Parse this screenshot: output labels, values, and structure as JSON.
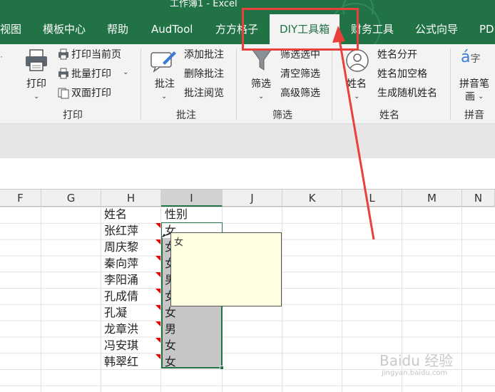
{
  "window": {
    "title": "工作簿1  -  Excel"
  },
  "tabs": [
    {
      "label": "视图",
      "active": false
    },
    {
      "label": "模板中心",
      "active": false
    },
    {
      "label": "帮助",
      "active": false
    },
    {
      "label": "AudTool",
      "active": false
    },
    {
      "label": "方方格子",
      "active": false
    },
    {
      "label": "DIY工具箱",
      "active": true
    },
    {
      "label": "财务工具",
      "active": false
    },
    {
      "label": "公式向导",
      "active": false
    },
    {
      "label": "PD",
      "active": false
    }
  ],
  "ribbon": {
    "print_group": {
      "print_label": "打印",
      "print_current_page": "打印当前页",
      "batch_print": "批量打印",
      "duplex_print": "双面打印",
      "group_name": "打印"
    },
    "comment_group": {
      "comment_label": "批注",
      "add_comment": "添加批注",
      "delete_comment": "删除批注",
      "comment_review": "批注阅览",
      "group_name": "批注"
    },
    "filter_group": {
      "filter_label": "筛选",
      "filter_selected": "筛选选中",
      "clear_filter": "清空筛选",
      "advanced_filter": "高级筛选",
      "group_name": "筛选"
    },
    "name_group": {
      "name_label": "姓名",
      "name_split": "姓名分开",
      "name_add_space": "姓名加空格",
      "random_name": "生成随机姓名",
      "group_name": "姓名"
    },
    "pinyin_group": {
      "pinyin_label": "拼音笔",
      "pinyin_label2": "画",
      "group_name": "拼音"
    }
  },
  "columns": [
    "F",
    "G",
    "H",
    "I",
    "J",
    "K",
    "L",
    "M",
    "N"
  ],
  "selected_column": "I",
  "sheet": {
    "header": {
      "name": "姓名",
      "gender": "性别"
    },
    "rows": [
      {
        "name": "张红萍",
        "gender": "女"
      },
      {
        "name": "周庆黎",
        "gender": "女"
      },
      {
        "name": "秦向萍",
        "gender": "女"
      },
      {
        "name": "李阳涌",
        "gender": "男"
      },
      {
        "name": "孔成倩",
        "gender": "女"
      },
      {
        "name": "孔凝",
        "gender": "女"
      },
      {
        "name": "龙章洪",
        "gender": "男"
      },
      {
        "name": "冯安琪",
        "gender": "女"
      },
      {
        "name": "韩翠红",
        "gender": "女"
      }
    ]
  },
  "comment": {
    "text": "女"
  },
  "watermark": {
    "brand": "Baidu 经验",
    "url": "jingyan.baidu.com"
  },
  "colors": {
    "excel_green": "#217346",
    "annotation_red": "#e8403a",
    "comment_bg": "#ffffe1"
  }
}
